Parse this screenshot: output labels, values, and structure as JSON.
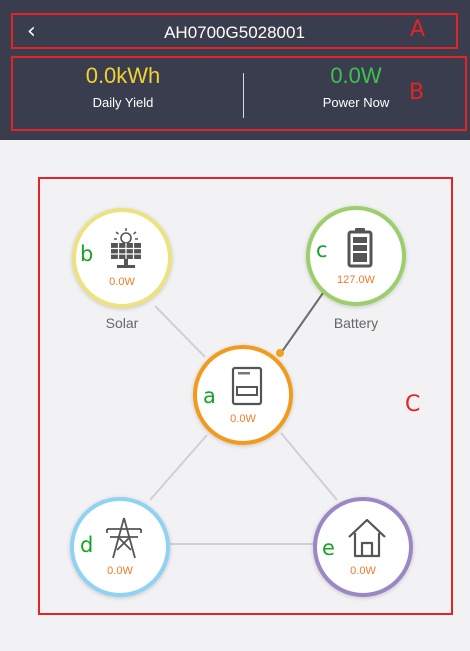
{
  "header": {
    "back_icon": "chevron-left-icon",
    "title": "AH0700G5028001",
    "annotation": "A"
  },
  "stats": {
    "daily_yield": {
      "value": "0.0kWh",
      "label": "Daily Yield",
      "color": "#f1d330"
    },
    "power_now": {
      "value": "0.0W",
      "label": "Power Now",
      "color": "#3dc24c"
    },
    "annotation": "B"
  },
  "flow": {
    "annotation": "C",
    "inverter": {
      "letter": "a",
      "power": "0.0W",
      "icon": "inverter-icon",
      "color": "#f29a1b"
    },
    "solar": {
      "letter": "b",
      "power": "0.0W",
      "label": "Solar",
      "icon": "solar-panel-icon",
      "color": "#ece37e"
    },
    "battery": {
      "letter": "c",
      "power": "127.0W",
      "label": "Battery",
      "icon": "battery-icon",
      "color": "#9bcf6a"
    },
    "grid": {
      "letter": "d",
      "power": "0.0W",
      "icon": "power-tower-icon",
      "color": "#8fd3f2"
    },
    "home": {
      "letter": "e",
      "power": "0.0W",
      "icon": "home-icon",
      "color": "#9b86c6"
    },
    "power_color": "#f07a2a",
    "line_color": "#d0d0d0",
    "active_line_color": "#6d6d6d",
    "flow_dot_color": "#f0a21e"
  }
}
